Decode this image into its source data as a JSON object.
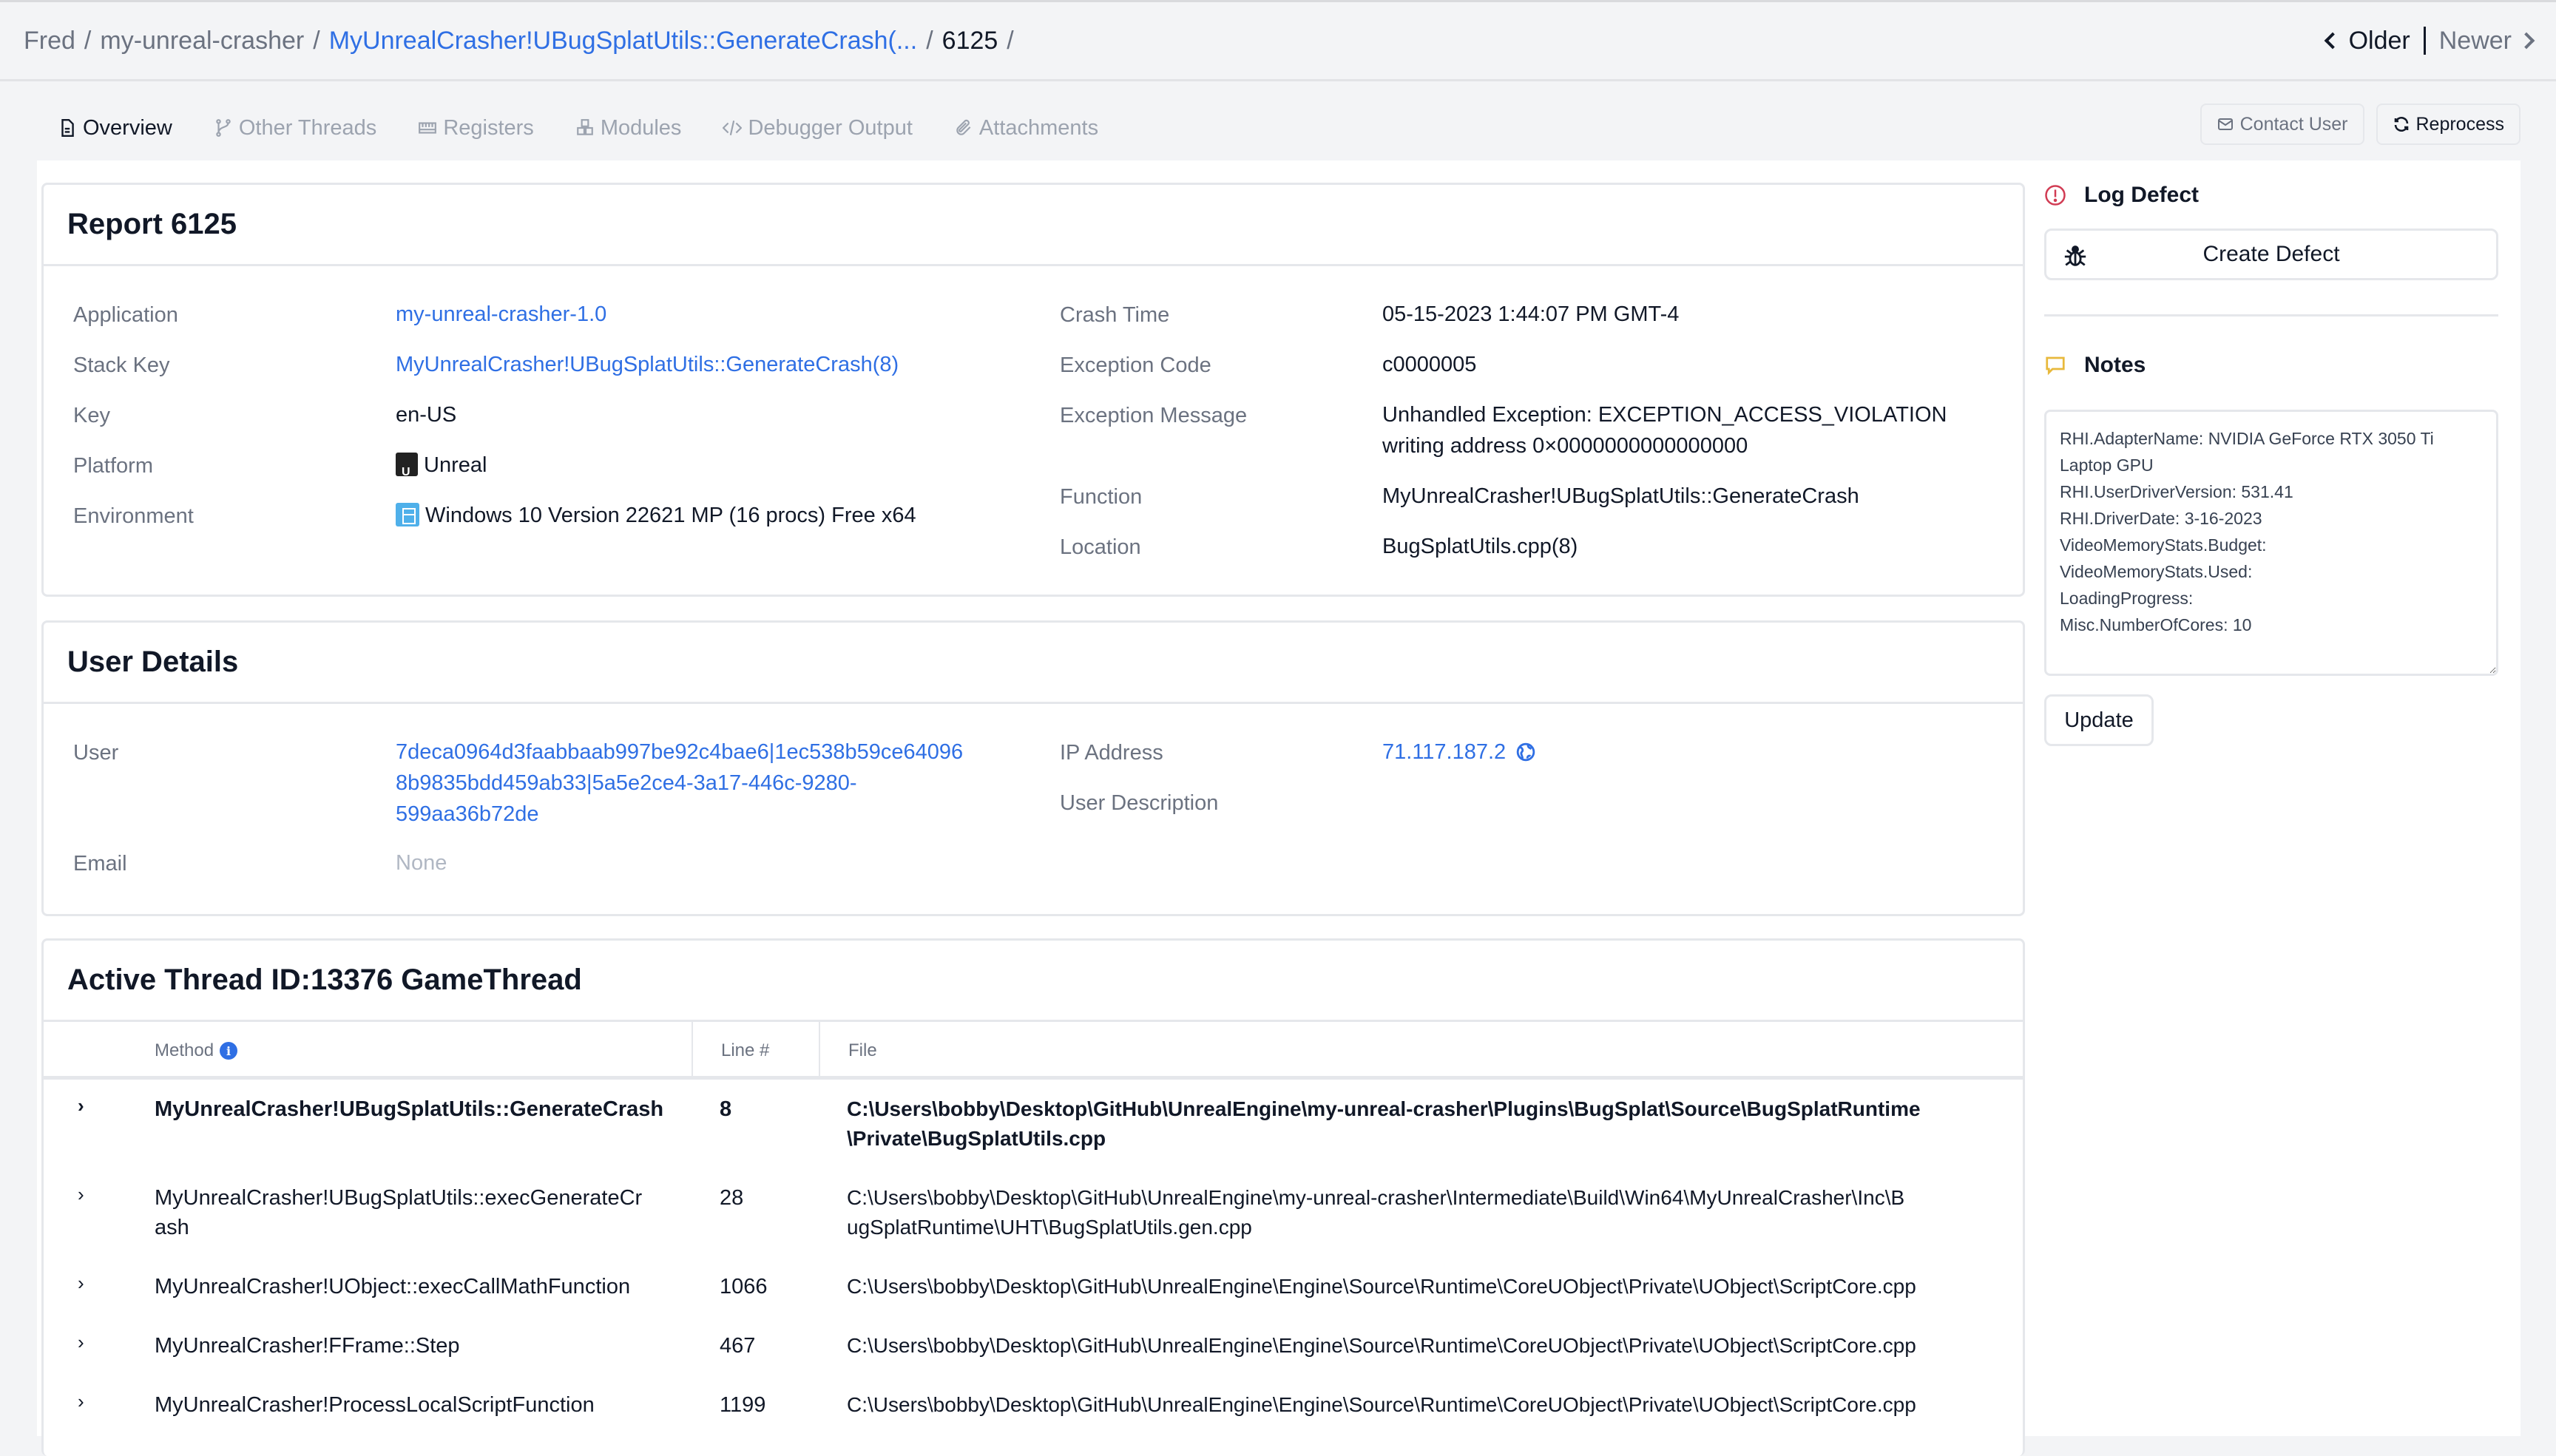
{
  "breadcrumb": {
    "items": [
      "Fred",
      "my-unreal-crasher",
      "MyUnrealCrasher!UBugSplatUtils::GenerateCrash(...",
      "6125"
    ],
    "separator": "/"
  },
  "pager": {
    "older": "Older",
    "newer": "Newer"
  },
  "tabs": [
    {
      "label": "Overview",
      "icon": "document-icon",
      "active": true
    },
    {
      "label": "Other Threads",
      "icon": "branch-icon",
      "active": false
    },
    {
      "label": "Registers",
      "icon": "memory-icon",
      "active": false
    },
    {
      "label": "Modules",
      "icon": "cubes-icon",
      "active": false
    },
    {
      "label": "Debugger Output",
      "icon": "code-icon",
      "active": false
    },
    {
      "label": "Attachments",
      "icon": "paperclip-icon",
      "active": false
    }
  ],
  "actions": {
    "contact_user": "Contact User",
    "reprocess": "Reprocess"
  },
  "report": {
    "title": "Report 6125",
    "left": [
      {
        "label": "Application",
        "value": "my-unreal-crasher-1.0"
      },
      {
        "label": "Stack Key",
        "value": "MyUnrealCrasher!UBugSplatUtils::GenerateCrash(8)"
      },
      {
        "label": "Key",
        "value": "en-US"
      },
      {
        "label": "Platform",
        "value": "Unreal"
      },
      {
        "label": "Environment",
        "value": "Windows 10 Version 22621 MP (16 procs) Free x64"
      }
    ],
    "right": [
      {
        "label": "Crash Time",
        "value": "05-15-2023 1:44:07 PM GMT-4"
      },
      {
        "label": "Exception Code",
        "value": "c0000005"
      },
      {
        "label": "Exception Message",
        "value": "Unhandled Exception: EXCEPTION_ACCESS_VIOLATION",
        "value2": "writing address 0×0000000000000000"
      },
      {
        "label": "Function",
        "value": "MyUnrealCrasher!UBugSplatUtils::GenerateCrash"
      },
      {
        "label": "Location",
        "value": "BugSplatUtils.cpp(8)"
      }
    ]
  },
  "user_details": {
    "title": "User Details",
    "user_label": "User",
    "user_lines": [
      "7deca0964d3faabbaab997be92c4bae6|1ec538b59ce64096",
      "8b9835bdd459ab33|5a5e2ce4-3a17-446c-9280-",
      "599aa36b72de"
    ],
    "email_label": "Email",
    "email_value": "None",
    "ip_label": "IP Address",
    "ip_value": "71.117.187.2",
    "desc_label": "User Description"
  },
  "thread": {
    "title": "Active Thread ID:13376 GameThread",
    "columns": {
      "method": "Method",
      "line": "Line #",
      "file": "File"
    },
    "rows": [
      {
        "method": [
          "MyUnrealCrasher!UBugSplatUtils::GenerateCrash"
        ],
        "line": "8",
        "file": [
          "C:\\Users\\bobby\\Desktop\\GitHub\\UnrealEngine\\my-unreal-crasher\\Plugins\\BugSplat\\Source\\BugSplatRuntime",
          "\\Private\\BugSplatUtils.cpp"
        ],
        "bold": true
      },
      {
        "method": [
          "MyUnrealCrasher!UBugSplatUtils::execGenerateCr",
          "ash"
        ],
        "line": "28",
        "file": [
          "C:\\Users\\bobby\\Desktop\\GitHub\\UnrealEngine\\my-unreal-crasher\\Intermediate\\Build\\Win64\\MyUnrealCrasher\\Inc\\B",
          "ugSplatRuntime\\UHT\\BugSplatUtils.gen.cpp"
        ],
        "bold": false
      },
      {
        "method": [
          "MyUnrealCrasher!UObject::execCallMathFunction"
        ],
        "line": "1066",
        "file": [
          "C:\\Users\\bobby\\Desktop\\GitHub\\UnrealEngine\\Engine\\Source\\Runtime\\CoreUObject\\Private\\UObject\\ScriptCore.cpp"
        ],
        "bold": false
      },
      {
        "method": [
          "MyUnrealCrasher!FFrame::Step"
        ],
        "line": "467",
        "file": [
          "C:\\Users\\bobby\\Desktop\\GitHub\\UnrealEngine\\Engine\\Source\\Runtime\\CoreUObject\\Private\\UObject\\ScriptCore.cpp"
        ],
        "bold": false
      },
      {
        "method": [
          "MyUnrealCrasher!ProcessLocalScriptFunction"
        ],
        "line": "1199",
        "file": [
          "C:\\Users\\bobby\\Desktop\\GitHub\\UnrealEngine\\Engine\\Source\\Runtime\\CoreUObject\\Private\\UObject\\ScriptCore.cpp"
        ],
        "bold": false
      }
    ]
  },
  "sidebar": {
    "log_defect_title": "Log Defect",
    "create_defect": "Create Defect",
    "notes_title": "Notes",
    "notes_value": "RHI.AdapterName: NVIDIA GeForce RTX 3050 Ti Laptop GPU\nRHI.UserDriverVersion: 531.41\nRHI.DriverDate: 3-16-2023\nVideoMemoryStats.Budget:\nVideoMemoryStats.Used:\nLoadingProgress:\nMisc.NumberOfCores: 10",
    "update": "Update"
  },
  "colors": {
    "link": "#2f6fe4",
    "tab_active": "#4f9ef0",
    "alert": "#d13b53",
    "notes_icon": "#e8b93c"
  }
}
